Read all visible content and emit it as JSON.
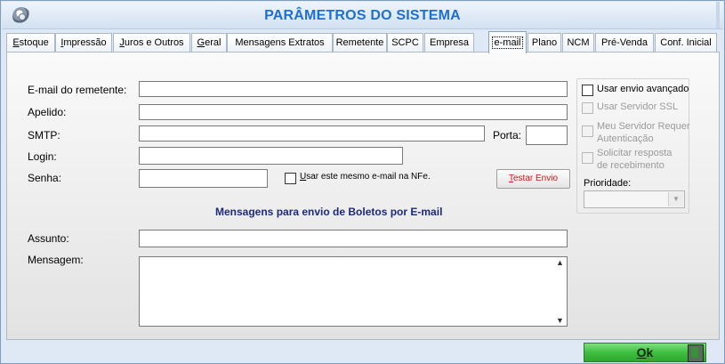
{
  "window": {
    "title": "PARÂMETROS DO SISTEMA"
  },
  "tabs": [
    {
      "label": "Estoque",
      "accel": "E",
      "rest": "stoque"
    },
    {
      "label": "Impressão",
      "accel": "I",
      "rest": "mpressão"
    },
    {
      "label": "Juros e Outros",
      "accel": "J",
      "rest": "uros e Outros"
    },
    {
      "label": "Geral",
      "accel": "G",
      "rest": "eral"
    },
    {
      "label": "Mensagens Extratos",
      "accel": "",
      "rest": "Mensagens Extratos"
    },
    {
      "label": "Remetente",
      "accel": "",
      "rest": "Remetente"
    },
    {
      "label": "SCPC",
      "accel": "",
      "rest": "SCPC"
    },
    {
      "label": "Empresa",
      "accel": "",
      "rest": "Empresa"
    },
    {
      "label": "e-mail",
      "accel": "",
      "rest": "e-mail"
    },
    {
      "label": "Plano",
      "accel": "",
      "rest": "Plano"
    },
    {
      "label": "NCM",
      "accel": "",
      "rest": "NCM"
    },
    {
      "label": "Pré-Venda",
      "accel": "",
      "rest": "Pré-Venda"
    },
    {
      "label": "Conf. Inicial",
      "accel": "",
      "rest": "Conf. Inicial"
    }
  ],
  "email_form": {
    "sender_label": "E-mail do remetente:",
    "sender_value": "",
    "nickname_label": "Apelido:",
    "nickname_value": "",
    "smtp_label": "SMTP:",
    "smtp_value": "",
    "port_label": "Porta:",
    "port_value": "",
    "login_label": "Login:",
    "login_value": "",
    "password_label": "Senha:",
    "password_value": "",
    "same_email_nfe_accel": "U",
    "same_email_nfe_rest": "sar este mesmo e-mail na NFe.",
    "test_button_accel": "T",
    "test_button_rest": "estar Envio"
  },
  "boletos": {
    "section_title": "Mensagens para envio de Boletos por E-mail",
    "subject_label": "Assunto:",
    "subject_value": "",
    "message_label": "Mensagem:",
    "message_value": ""
  },
  "advanced": {
    "use_advanced": "Usar envio avançado",
    "ssl": "Usar Servidor SSL",
    "auth_line1": "Meu Servidor Requer",
    "auth_line2": "Autenticação",
    "receipt_line1": "Solicitar resposta",
    "receipt_line2": "de recebimento",
    "priority_label": "Prioridade:",
    "priority_value": ""
  },
  "footer": {
    "ok_accel": "O",
    "ok_rest": "k"
  },
  "colors": {
    "title": "#1f6fd1",
    "section_title": "#1d2a7a",
    "test_button_text": "#d61515",
    "ok_button": "#3fbf3f"
  },
  "icons": {
    "title": "gear-icon",
    "scroll_up": "arrow-up-icon",
    "scroll_down": "arrow-down-icon",
    "select": "chevron-down-icon",
    "ok": "exit-door-icon"
  }
}
